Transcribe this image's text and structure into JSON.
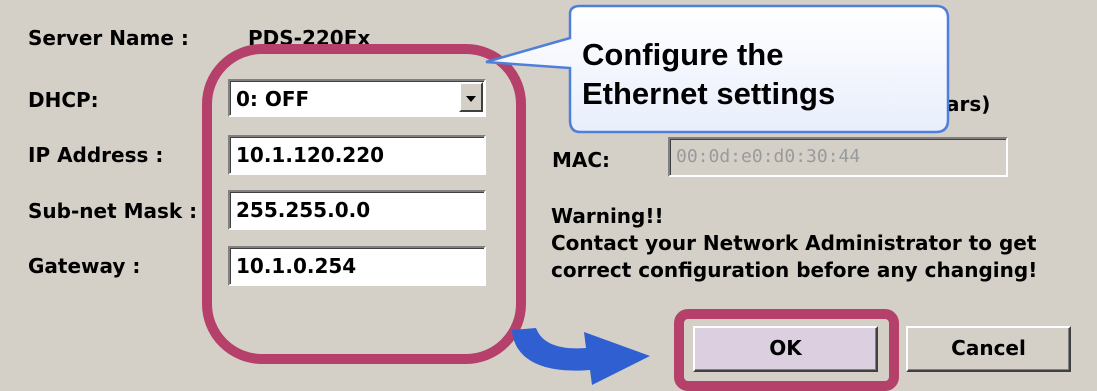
{
  "labels": {
    "server_name": "Server Name :",
    "dhcp": "DHCP:",
    "ip_address": "IP Address :",
    "subnet_mask": "Sub-net Mask :",
    "gateway": "Gateway :",
    "mac": "MAC:"
  },
  "values": {
    "server_name": "PDS-220Fx",
    "dhcp_selected": "0: OFF",
    "ip_address": "10.1.120.220",
    "subnet_mask": "255.255.0.0",
    "gateway": "10.1.0.254",
    "mac": "00:0d:e0:d0:30:44",
    "hidden_hint_suffix": "ars)"
  },
  "warning": {
    "title": "Warning!!",
    "line1": "Contact your Network Administrator to get",
    "line2": "correct  configuration before any changing!"
  },
  "buttons": {
    "ok": "OK",
    "cancel": "Cancel"
  },
  "callout": {
    "line1": "Configure the",
    "line2": "Ethernet settings"
  },
  "colors": {
    "dialog_bg": "#d4d0c8",
    "highlight_ring": "#b5406a",
    "callout_border": "#4f7fd8",
    "arrow": "#2f5fd1"
  }
}
